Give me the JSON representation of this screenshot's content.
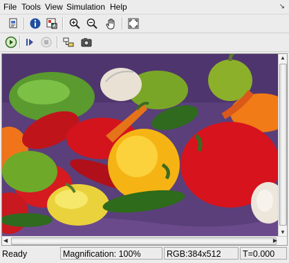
{
  "menu": {
    "items": [
      "File",
      "Tools",
      "View",
      "Simulation",
      "Help"
    ],
    "pin_icon": "pin-arrow-icon"
  },
  "toolbar1": {
    "buttons": [
      "print-model-icon",
      "info-icon",
      "pixel-region-icon",
      "zoom-in-icon",
      "zoom-out-icon",
      "pan-hand-icon",
      "fit-to-window-icon"
    ]
  },
  "toolbar2": {
    "buttons": [
      "run-icon",
      "step-forward-icon",
      "stop-icon",
      "highlight-block-icon",
      "snapshot-camera-icon"
    ]
  },
  "image": {
    "subject": "peppers"
  },
  "status": {
    "ready": "Ready",
    "magnification": "Magnification: 100%",
    "rgb": "RGB:384x512",
    "time": "T=0.000"
  }
}
